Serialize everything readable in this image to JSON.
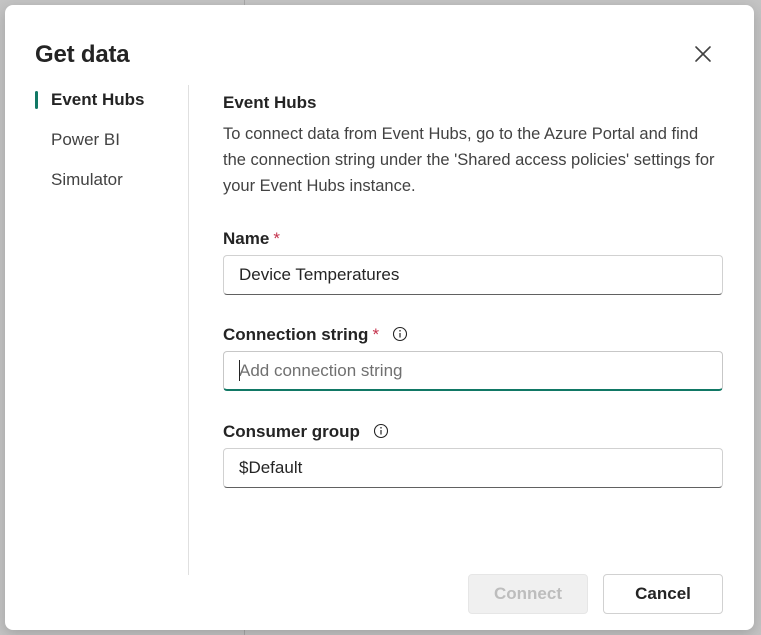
{
  "dialog": {
    "title": "Get data",
    "close_icon": "close-icon"
  },
  "nav": {
    "items": [
      {
        "label": "Event Hubs",
        "active": true
      },
      {
        "label": "Power BI",
        "active": false
      },
      {
        "label": "Simulator",
        "active": false
      }
    ]
  },
  "content": {
    "section_title": "Event Hubs",
    "description": "To connect data from Event Hubs, go to the Azure Portal and find the connection string under the 'Shared access policies' settings for your Event Hubs instance.",
    "fields": {
      "name": {
        "label": "Name",
        "required_marker": "*",
        "value": "Device Temperatures"
      },
      "connection_string": {
        "label": "Connection string",
        "required_marker": "*",
        "info_icon": "info-icon",
        "value": "",
        "placeholder": "Add connection string"
      },
      "consumer_group": {
        "label": "Consumer group",
        "info_icon": "info-icon",
        "value": "$Default"
      }
    }
  },
  "footer": {
    "connect_label": "Connect",
    "connect_disabled": true,
    "cancel_label": "Cancel"
  },
  "colors": {
    "accent": "#117865",
    "required": "#c4314b",
    "disabled_text": "#bdbdbd"
  }
}
